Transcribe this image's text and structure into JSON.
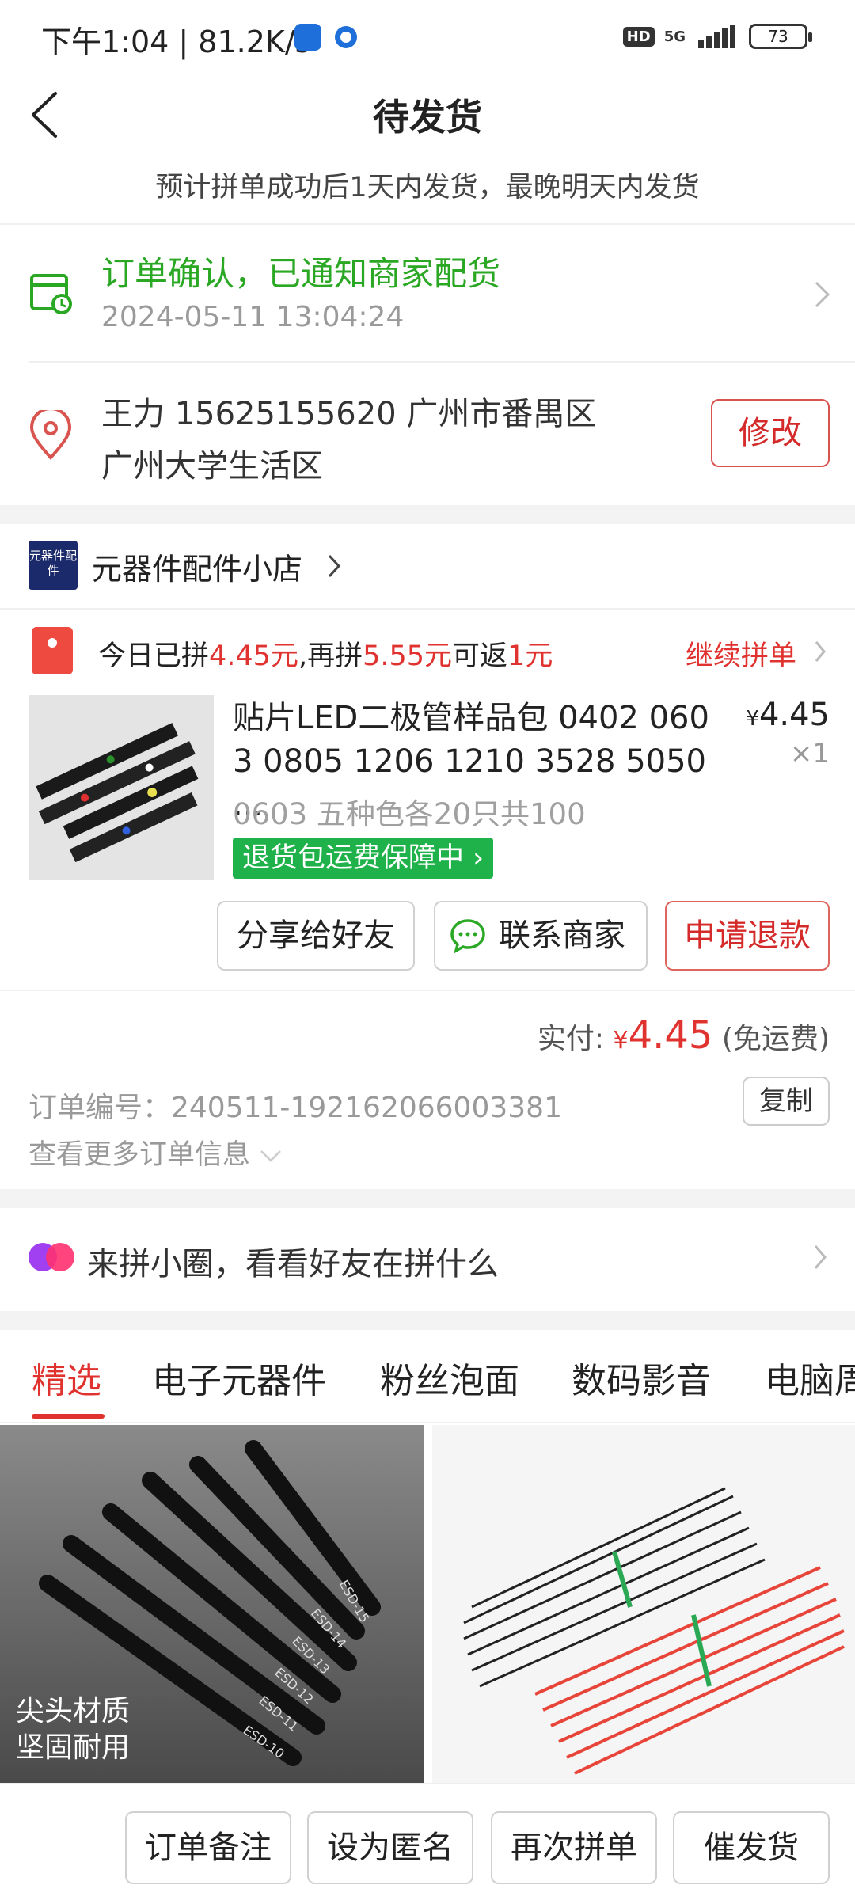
{
  "status_bar": {
    "time_speed": "下午1:04 | 81.2K/s",
    "network": "5G",
    "hd": "HD",
    "battery": "73"
  },
  "header": {
    "title": "待发货",
    "subtitle": "预计拼单成功后1天内发货，最晚明天内发货"
  },
  "order_status": {
    "text": "订单确认，已通知商家配货",
    "time": "2024-05-11 13:04:24"
  },
  "address": {
    "line1": "王力  15625155620  广州市番禺区",
    "line2": "广州大学生活区",
    "edit_label": "修改"
  },
  "shop": {
    "logo_text": "元器件配件",
    "name": "元器件配件小店"
  },
  "group_buy": {
    "prefix": "今日已拼",
    "amount1": "4.45元",
    "mid": ",再拼",
    "amount2": "5.55元",
    "mid2": "可返",
    "amount3": "1元",
    "continue_label": "继续拼单"
  },
  "product": {
    "title_line1": "贴片LED二极管样品包 0402 060",
    "title_line2": "3 0805 1206 1210 3528 5050 ...",
    "currency": "¥",
    "price": "4.45",
    "qty": "×1",
    "sku": "0603 五种色各20只共100",
    "guarantee": "退货包运费保障中"
  },
  "actions": {
    "share": "分享给好友",
    "contact": "联系商家",
    "refund": "申请退款"
  },
  "payment": {
    "label": "实付: ",
    "currency": "¥",
    "amount": "4.45",
    "note": "(免运费)"
  },
  "order_info": {
    "number": "订单编号：240511-192162066003381",
    "copy_label": "复制",
    "more": "查看更多订单信息"
  },
  "circle": {
    "text": "来拼小圈，看看好友在拼什么"
  },
  "tabs": [
    "精选",
    "电子元器件",
    "粉丝泡面",
    "数码影音",
    "电脑周"
  ],
  "grid": {
    "left_caption1": "尖头材质",
    "left_caption2": "坚固耐用",
    "tweezer_labels": [
      "ESD-10",
      "ESD-11",
      "ESD-12",
      "ESD-13",
      "ESD-14",
      "ESD-15"
    ]
  },
  "bottom_bar": {
    "remark": "订单备注",
    "anonymous": "设为匿名",
    "rebuy": "再次拼单",
    "urge": "催发货"
  },
  "colors": {
    "accent_red": "#e0322f",
    "success_green": "#2aa824",
    "guarantee_green": "#1fb24a"
  }
}
